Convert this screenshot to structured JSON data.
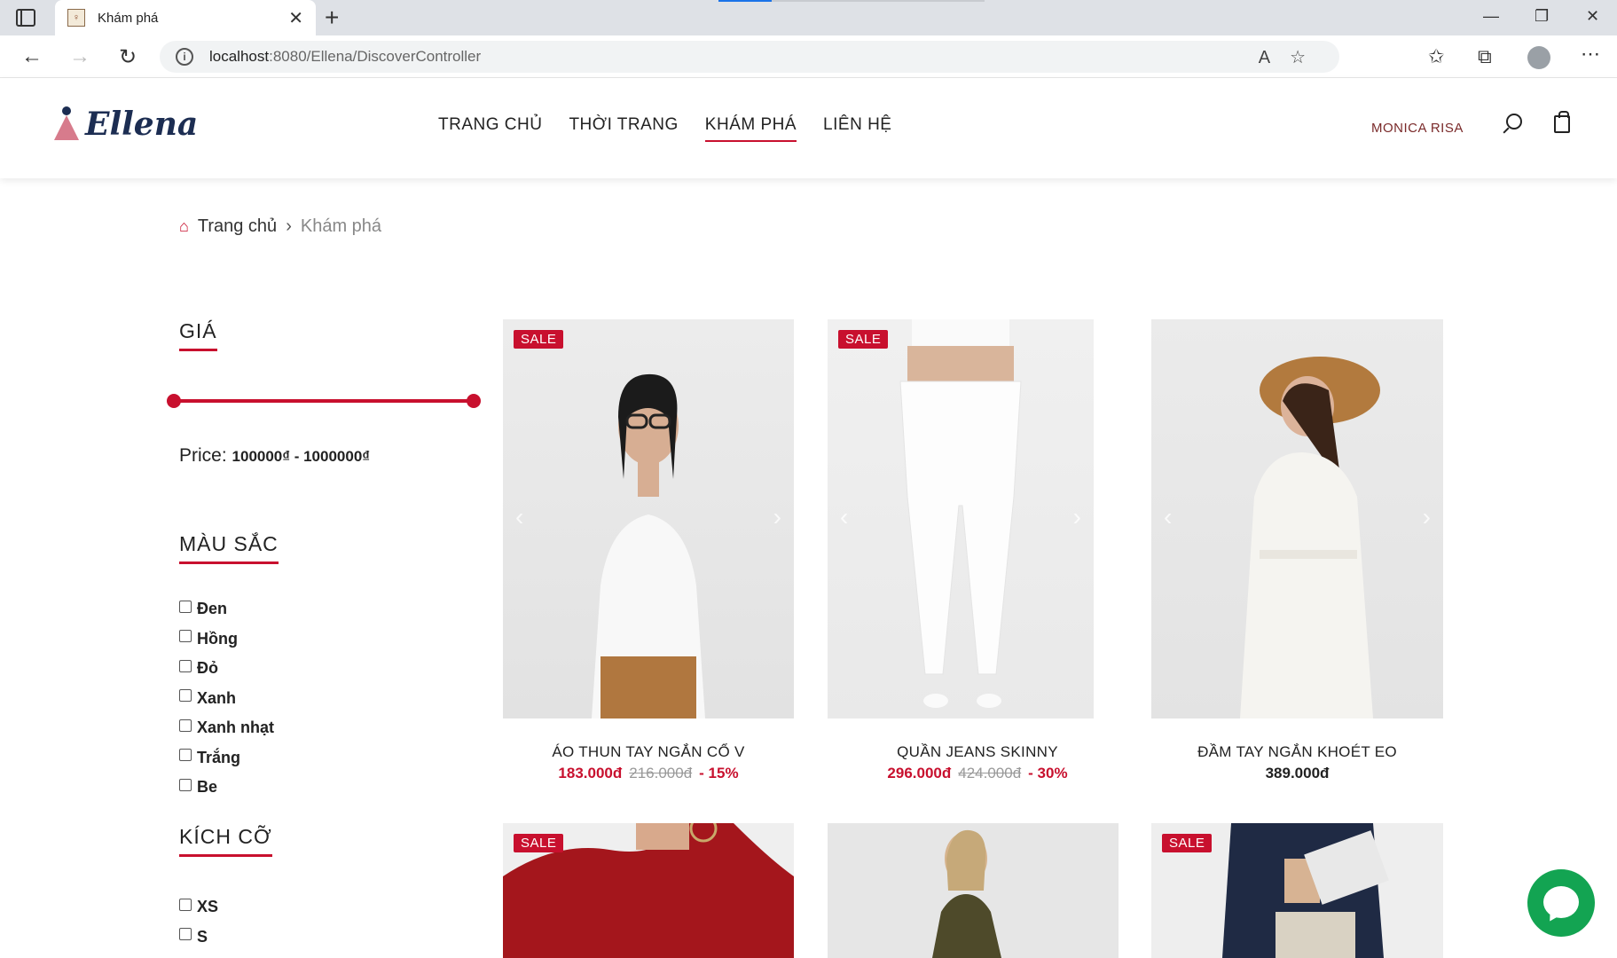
{
  "browser": {
    "tab_title": "Khám phá",
    "url_host": "localhost",
    "url_path": ":8080/Ellena/DiscoverController",
    "icons": [
      "tab-actions-icon",
      "close-icon",
      "plus-icon",
      "minimize-icon",
      "restore-icon",
      "close-window-icon",
      "back-icon",
      "forward-icon",
      "refresh-icon",
      "info-icon",
      "read-aloud-icon",
      "add-favorite-icon",
      "favorites-icon",
      "collections-icon",
      "profile-icon",
      "more-icon"
    ]
  },
  "header": {
    "logo_text": "Ellena",
    "nav": [
      {
        "label": "TRANG CHỦ",
        "active": false
      },
      {
        "label": "THỜI TRANG",
        "active": false
      },
      {
        "label": "KHÁM PHÁ",
        "active": true
      },
      {
        "label": "LIÊN HỆ",
        "active": false
      }
    ],
    "user_name": "MONICA RISA"
  },
  "breadcrumb": {
    "home": "Trang chủ",
    "current": "Khám phá"
  },
  "filters": {
    "price_title": "GIÁ",
    "price_label": "Price:",
    "price_min": "100000₫",
    "price_sep": " - ",
    "price_max": "1000000₫",
    "color_title": "MÀU SẮC",
    "colors": [
      "Đen",
      "Hồng",
      "Đỏ",
      "Xanh",
      "Xanh nhạt",
      "Trắng",
      "Be"
    ],
    "size_title": "KÍCH CỠ",
    "sizes": [
      "XS",
      "S"
    ]
  },
  "products": [
    {
      "name": "ÁO THUN TAY NGẮN CỔ V",
      "price": "183.000đ",
      "old_price": "216.000đ",
      "discount": "- 15%",
      "sale": "SALE"
    },
    {
      "name": "QUẦN JEANS SKINNY",
      "price": "296.000đ",
      "old_price": "424.000đ",
      "discount": "- 30%",
      "sale": "SALE"
    },
    {
      "name": "ĐẦM TAY NGẮN KHOÉT EO",
      "price": "389.000đ"
    },
    {
      "sale": "SALE"
    },
    {},
    {
      "sale": "SALE"
    }
  ],
  "colors": {
    "accent": "#c8102e",
    "chat": "#13a452",
    "logo": "#1c2d52"
  }
}
